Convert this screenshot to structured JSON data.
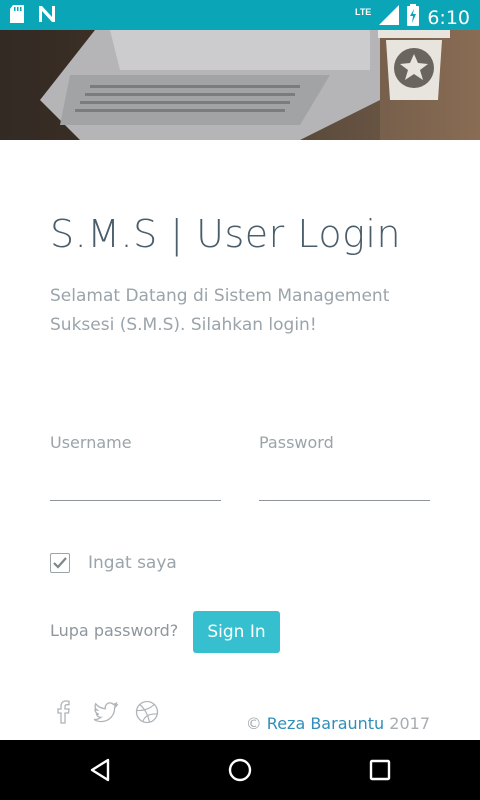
{
  "status_bar": {
    "time": "6:10",
    "network": "LTE",
    "left_icons": [
      "sd-card-icon",
      "notification-n-icon"
    ],
    "right_icons": [
      "lte-signal-icon",
      "signal-icon",
      "battery-charging-icon"
    ],
    "background": "#0aa5b7"
  },
  "hero": {
    "logo_icon": "bin-star-icon"
  },
  "login": {
    "title": "S.M.S | User Login",
    "subtitle": "Selamat Datang di Sistem Management Suksesi (S.M.S). Silahkan login!",
    "username_label": "Username",
    "username_value": "",
    "password_label": "Password",
    "password_value": "",
    "remember_label": "Ingat saya",
    "remember_checked": true,
    "forgot_label": "Lupa password?",
    "signin_label": "Sign In",
    "accent_color": "#36c0cf"
  },
  "social_icons": [
    "facebook-icon",
    "twitter-icon",
    "dribbble-icon"
  ],
  "footer": {
    "copyright": "©",
    "author": "Reza Barauntu",
    "year": "2017"
  },
  "nav_bar": {
    "buttons": [
      "back-icon",
      "home-icon",
      "recents-icon"
    ]
  }
}
